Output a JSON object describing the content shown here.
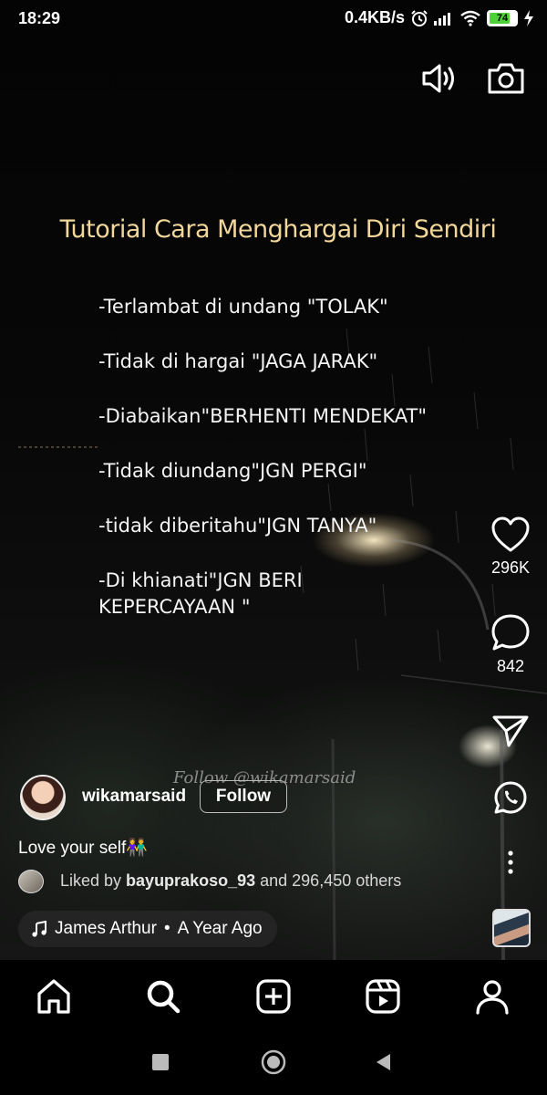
{
  "status_bar": {
    "time": "18:29",
    "network_speed": "0.4KB/s",
    "battery_level": "74",
    "battery_percent": 74,
    "icons": [
      "alarm-icon",
      "signal-icon",
      "wifi-icon",
      "battery-icon",
      "charging-icon"
    ]
  },
  "top_actions": [
    "sound-icon",
    "camera-icon"
  ],
  "post_overlay": {
    "title": "Tutorial Cara Menghargai Diri Sendiri",
    "items": [
      "-Terlambat  di undang \"TOLAK\"",
      "-Tidak di hargai \"JAGA JARAK\"",
      "-Diabaikan\"BERHENTI MENDEKAT\"",
      "-Tidak diundang\"JGN PERGI\"",
      "-tidak diberitahu\"JGN TANYA\"",
      "-Di khianati\"JGN BERI KEPERCAYAAN \""
    ],
    "watermark": "Follow @wikamarsaid"
  },
  "actions": {
    "likes": "296K",
    "comments": "842"
  },
  "author": {
    "username": "wikamarsaid",
    "follow_label": "Follow"
  },
  "caption": "Love your self👫",
  "liked_by": {
    "prefix": "Liked by ",
    "user": "bayuprakoso_93",
    "suffix": " and 296,450 others"
  },
  "music": {
    "artist": "James Arthur",
    "separator": "•",
    "time_ago": "A Year Ago"
  },
  "bottom_nav": [
    "home-icon",
    "search-icon",
    "create-icon",
    "reels-icon",
    "profile-icon"
  ],
  "colors": {
    "title": "#f2d79a",
    "battery": "#4cd137",
    "background": "#000000"
  }
}
